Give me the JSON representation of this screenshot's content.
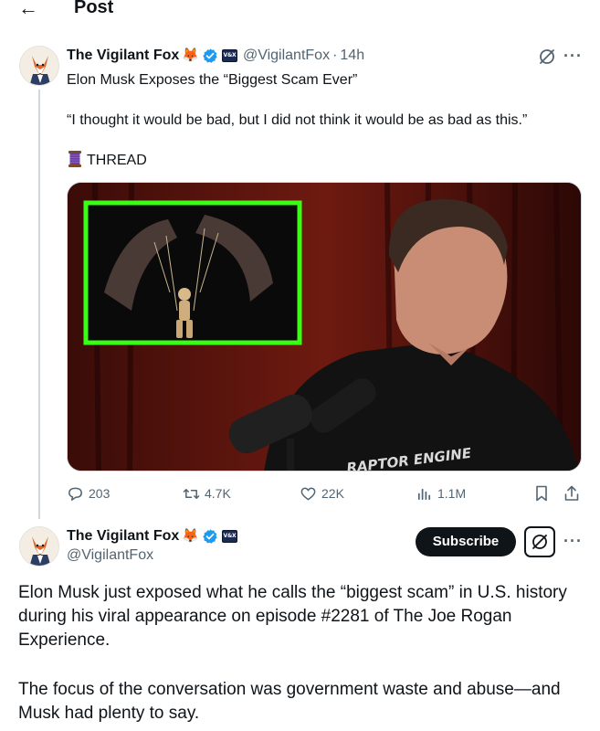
{
  "header": {
    "back_icon": "arrow-left-icon",
    "title": "Post"
  },
  "first_post": {
    "display_name": "The Vigilant Fox",
    "name_emoji": "🦊",
    "affiliate_badge_text": "V&X",
    "handle": "@VigilantFox",
    "separator": "·",
    "time": "14h",
    "line1": "Elon Musk Exposes the “Biggest Scam Ever”",
    "line2": "“I thought it would be bad, but I did not think it would be as bad as this.”",
    "thread_icon": "spool-of-thread-icon",
    "thread_label": "THREAD",
    "media": {
      "shirt_text": "RAPTOR ENGINE",
      "inset_border_color": "#39ff14"
    },
    "stats": {
      "replies": "203",
      "reposts": "4.7K",
      "likes": "22K",
      "views": "1.1M"
    }
  },
  "second_post": {
    "display_name": "The Vigilant Fox",
    "name_emoji": "🦊",
    "affiliate_badge_text": "V&X",
    "handle": "@VigilantFox",
    "subscribe_label": "Subscribe",
    "paragraph1": "Elon Musk just exposed what he calls the “biggest scam” in U.S. history during his viral appearance on episode #2281 of The Joe Rogan Experience.",
    "paragraph2": "The focus of the conversation was government waste and abuse—and Musk had plenty to say."
  },
  "colors": {
    "text_primary": "#0f1419",
    "text_secondary": "#536471",
    "verified_blue": "#1d9bf0",
    "button_dark": "#0f1419",
    "border": "#cfd9de"
  }
}
